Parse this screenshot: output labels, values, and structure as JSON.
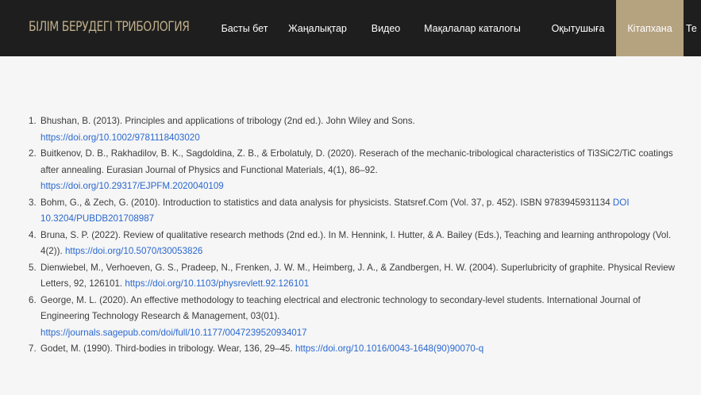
{
  "site": {
    "title": "БІЛІМ БЕРУДЕГІ ТРИБОЛОГИЯ"
  },
  "nav": {
    "items": [
      {
        "label": "Басты бет"
      },
      {
        "label": "Жаңалықтар"
      },
      {
        "label": "Видео"
      },
      {
        "label": "Мақалалар каталогы"
      },
      {
        "label": "Оқытушыға"
      },
      {
        "label": "Кітапхана",
        "active": true
      },
      {
        "label": "Те"
      }
    ],
    "active_color": "#b5a27f"
  },
  "colors": {
    "header_bg": "#1e1e1e",
    "title": "#bfae8a",
    "link": "#2a68cf",
    "text": "#3c3c3c"
  },
  "references": [
    {
      "num": "1.",
      "text": "Bhushan, B. (2013). Principles and applications of tribology (2nd ed.). John Wiley and Sons.",
      "link": "https://doi.org/10.1002/9781118403020"
    },
    {
      "num": "2.",
      "text": "Buitkenov, D. B., Rakhadilov, B. K., Sagdoldina, Z. B., & Erbolatuly, D. (2020). Reserach of the mechanic-tribological characteristics of Ti3SiC2/TiC coatings after annealing. Eurasian Journal of Physics and Functional Materials, 4(1), 86–92.",
      "link": "https://doi.org/10.29317/EJPFM.2020040109"
    },
    {
      "num": "3.",
      "text": "Bohm, G., & Zech, G. (2010). Introduction to statistics and data analysis for physicists. Statsref.Com (Vol. 37, p. 452). ISBN 9783945931134",
      "link": "DOI 10.3204/PUBDB201708987"
    },
    {
      "num": "4.",
      "text": "Bruna, S. P. (2022). Review of qualitative research methods (2nd ed.). In M. Hennink, I. Hutter, & A. Bailey (Eds.), Teaching and learning anthropology (Vol. 4(2)).",
      "link": "https://doi.org/10.5070/t30053826"
    },
    {
      "num": "5.",
      "text": "Dienwiebel, M., Verhoeven, G. S., Pradeep, N., Frenken, J. W. M., Heimberg, J. A., & Zandbergen, H. W. (2004). Superlubricity of graphite. Physical Review Letters, 92, 126101.",
      "link": "https://doi.org/10.1103/physrevlett.92.126101"
    },
    {
      "num": "6.",
      "text": "George, M. L. (2020). An effective methodology to teaching electrical and electronic technology to secondary-level students. International Journal of Engineering Technology Research & Management, 03(01).",
      "link": "https://journals.sagepub.com/doi/full/10.1177/0047239520934017"
    },
    {
      "num": "7.",
      "text": "Godet, M. (1990). Third-bodies in tribology. Wear, 136, 29–45.",
      "link": "https://doi.org/10.1016/0043-1648(90)90070-q"
    }
  ]
}
